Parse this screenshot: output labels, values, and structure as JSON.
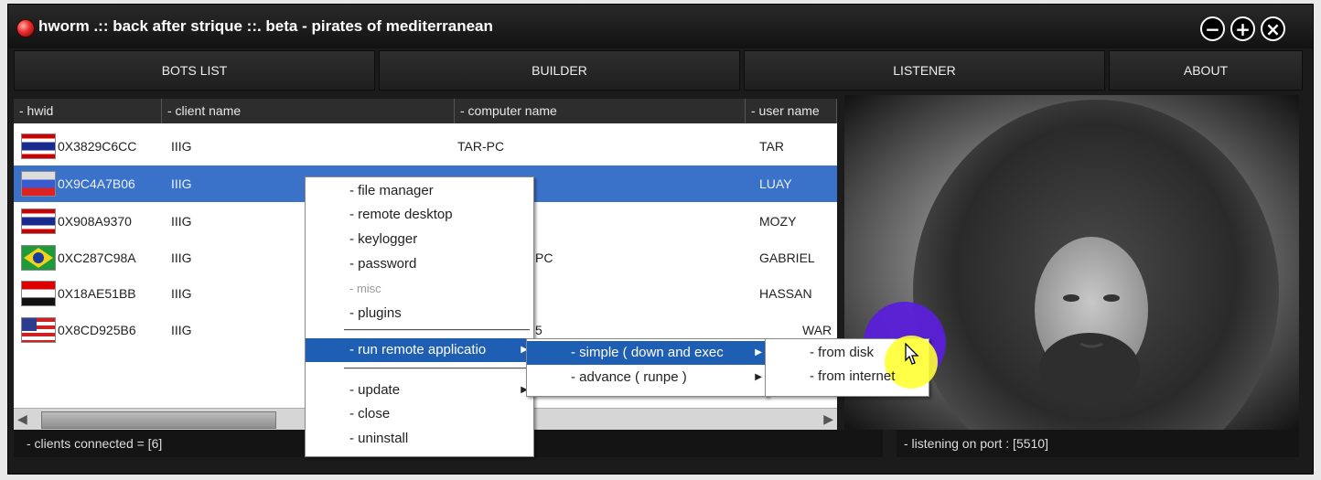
{
  "window": {
    "title": "hworm .:: back after strique ::. beta - pirates of mediterranean"
  },
  "controls": {
    "minimize": "−",
    "maximize": "+",
    "close": "×"
  },
  "nav": [
    "BOTS LIST",
    "BUILDER",
    "LISTENER",
    "ABOUT"
  ],
  "table": {
    "columns": [
      "- hwid",
      "- client name",
      "- computer name",
      "- user name"
    ],
    "rows": [
      {
        "flag": "thailand-flag-icon",
        "hwid": "0X3829C6CC",
        "client": "IIIG",
        "computer": "TAR-PC",
        "user": "TAR"
      },
      {
        "flag": "russia-flag-icon",
        "hwid": "0X9C4A7B06",
        "client": "IIIG",
        "computer": "",
        "user": "LUAY"
      },
      {
        "flag": "thailand-flag-icon",
        "hwid": "0X908A9370",
        "client": "IIIG",
        "computer": "",
        "user": "MOZY"
      },
      {
        "flag": "brazil-flag-icon",
        "hwid": "0XC287C98A",
        "client": "IIIG",
        "computer": "PC",
        "user": "GABRIEL"
      },
      {
        "flag": "egypt-flag-icon",
        "hwid": "0X18AE51BB",
        "client": "IIIG",
        "computer": "",
        "user": "HASSAN"
      },
      {
        "flag": "usa-flag-icon",
        "hwid": "0X8CD925B6",
        "client": "IIIG",
        "computer": "5",
        "user": "WAR"
      }
    ]
  },
  "status": {
    "clients": "- clients connected = [6]",
    "listening": "- listening on port : [5510]"
  },
  "context_menu": {
    "items": [
      "- file manager",
      "- remote desktop",
      "- keylogger",
      "- password",
      "- misc",
      "- plugins",
      "- run remote applicatio",
      "- update",
      "- close",
      "- uninstall"
    ],
    "submenu": [
      "- simple ( down and exec",
      "- advance ( runpe )"
    ],
    "submenu2": [
      "- from disk",
      "- from internet"
    ]
  },
  "colors": {
    "selection": "#3b72c9",
    "menu_highlight": "#1f5fb3",
    "cursor_highlight": "#ffff33",
    "circle": "#5a1fd8"
  }
}
